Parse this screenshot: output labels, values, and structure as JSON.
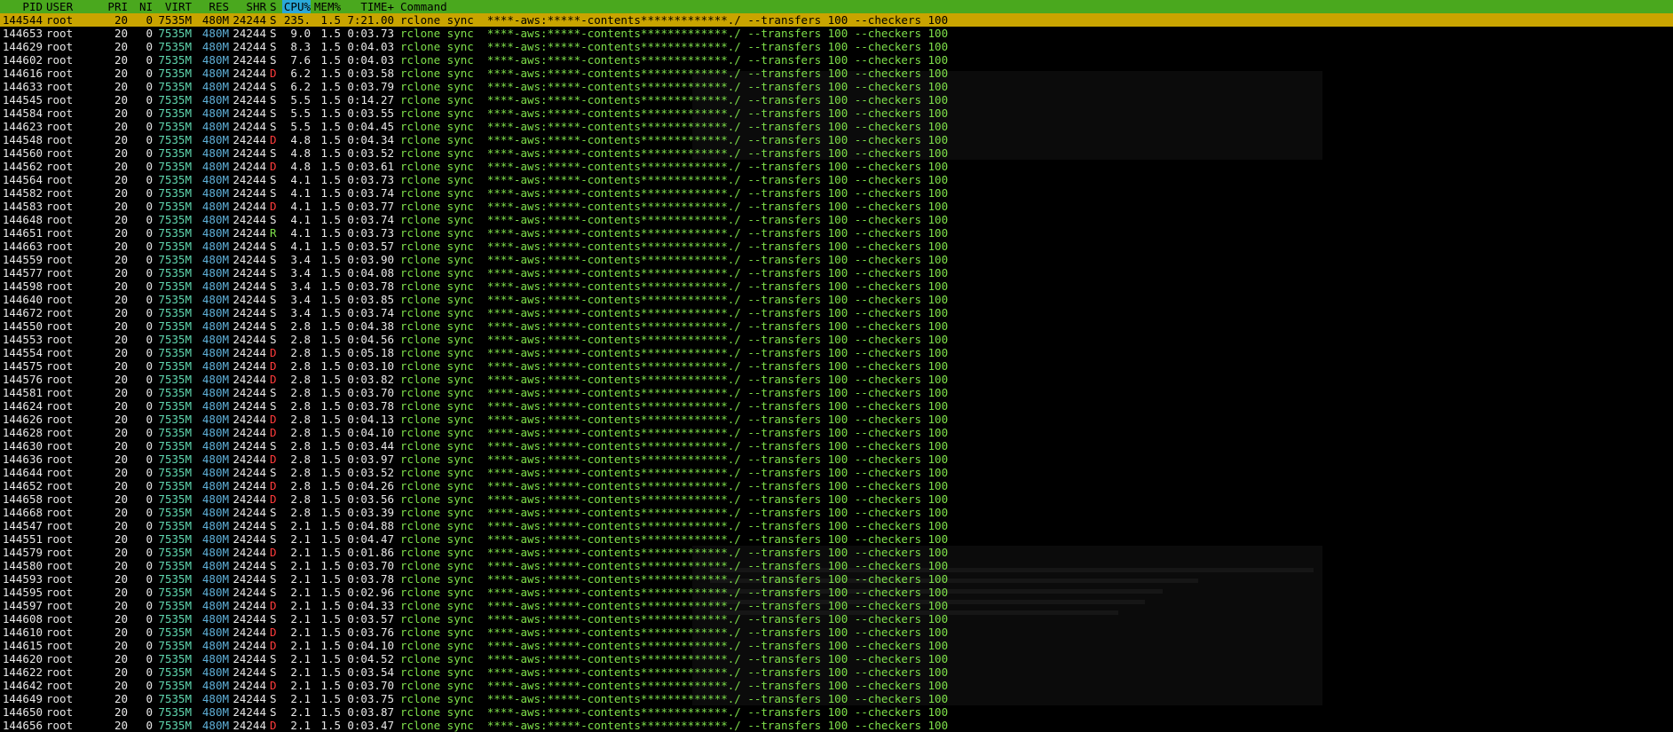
{
  "header": {
    "pid": "PID",
    "user": "USER",
    "pri": "PRI",
    "ni": "NI",
    "virt": "VIRT",
    "res": "RES",
    "shr": "SHR",
    "s": "S",
    "cpu": "CPU%",
    "mem": "MEM%",
    "time": "TIME+",
    "command": "Command"
  },
  "selected_index": 0,
  "command_text": "rclone sync  ****-aws:*****-contents*************./ --transfers 100 --checkers 100",
  "defaults": {
    "user": "root",
    "pri": "20",
    "ni": "0",
    "virt": "7535M",
    "res": "480M",
    "shr": "24244",
    "mem": "1.5"
  },
  "processes": [
    {
      "pid": "144544",
      "s": "S",
      "cpu": "235.",
      "time": "7:21.00"
    },
    {
      "pid": "144653",
      "s": "S",
      "cpu": "9.0",
      "time": "0:03.73"
    },
    {
      "pid": "144629",
      "s": "S",
      "cpu": "8.3",
      "time": "0:04.03"
    },
    {
      "pid": "144602",
      "s": "S",
      "cpu": "7.6",
      "time": "0:04.03"
    },
    {
      "pid": "144616",
      "s": "D",
      "cpu": "6.2",
      "time": "0:03.58"
    },
    {
      "pid": "144633",
      "s": "S",
      "cpu": "6.2",
      "time": "0:03.79"
    },
    {
      "pid": "144545",
      "s": "S",
      "cpu": "5.5",
      "time": "0:14.27"
    },
    {
      "pid": "144584",
      "s": "S",
      "cpu": "5.5",
      "time": "0:03.55"
    },
    {
      "pid": "144623",
      "s": "S",
      "cpu": "5.5",
      "time": "0:04.45"
    },
    {
      "pid": "144548",
      "s": "D",
      "cpu": "4.8",
      "time": "0:04.34"
    },
    {
      "pid": "144560",
      "s": "S",
      "cpu": "4.8",
      "time": "0:03.52"
    },
    {
      "pid": "144562",
      "s": "D",
      "cpu": "4.8",
      "time": "0:03.61"
    },
    {
      "pid": "144564",
      "s": "S",
      "cpu": "4.1",
      "time": "0:03.73"
    },
    {
      "pid": "144582",
      "s": "S",
      "cpu": "4.1",
      "time": "0:03.74"
    },
    {
      "pid": "144583",
      "s": "D",
      "cpu": "4.1",
      "time": "0:03.77"
    },
    {
      "pid": "144648",
      "s": "S",
      "cpu": "4.1",
      "time": "0:03.74"
    },
    {
      "pid": "144651",
      "s": "R",
      "cpu": "4.1",
      "time": "0:03.73"
    },
    {
      "pid": "144663",
      "s": "S",
      "cpu": "4.1",
      "time": "0:03.57"
    },
    {
      "pid": "144559",
      "s": "S",
      "cpu": "3.4",
      "time": "0:03.90"
    },
    {
      "pid": "144577",
      "s": "S",
      "cpu": "3.4",
      "time": "0:04.08"
    },
    {
      "pid": "144598",
      "s": "S",
      "cpu": "3.4",
      "time": "0:03.78"
    },
    {
      "pid": "144640",
      "s": "S",
      "cpu": "3.4",
      "time": "0:03.85"
    },
    {
      "pid": "144672",
      "s": "S",
      "cpu": "3.4",
      "time": "0:03.74"
    },
    {
      "pid": "144550",
      "s": "S",
      "cpu": "2.8",
      "time": "0:04.38"
    },
    {
      "pid": "144553",
      "s": "S",
      "cpu": "2.8",
      "time": "0:04.56"
    },
    {
      "pid": "144554",
      "s": "D",
      "cpu": "2.8",
      "time": "0:05.18"
    },
    {
      "pid": "144575",
      "s": "D",
      "cpu": "2.8",
      "time": "0:03.10"
    },
    {
      "pid": "144576",
      "s": "D",
      "cpu": "2.8",
      "time": "0:03.82"
    },
    {
      "pid": "144581",
      "s": "S",
      "cpu": "2.8",
      "time": "0:03.70"
    },
    {
      "pid": "144624",
      "s": "S",
      "cpu": "2.8",
      "time": "0:03.78"
    },
    {
      "pid": "144626",
      "s": "D",
      "cpu": "2.8",
      "time": "0:04.13"
    },
    {
      "pid": "144628",
      "s": "D",
      "cpu": "2.8",
      "time": "0:04.10"
    },
    {
      "pid": "144630",
      "s": "S",
      "cpu": "2.8",
      "time": "0:03.44"
    },
    {
      "pid": "144636",
      "s": "D",
      "cpu": "2.8",
      "time": "0:03.97"
    },
    {
      "pid": "144644",
      "s": "S",
      "cpu": "2.8",
      "time": "0:03.52"
    },
    {
      "pid": "144652",
      "s": "D",
      "cpu": "2.8",
      "time": "0:04.26"
    },
    {
      "pid": "144658",
      "s": "D",
      "cpu": "2.8",
      "time": "0:03.56"
    },
    {
      "pid": "144668",
      "s": "S",
      "cpu": "2.8",
      "time": "0:03.39"
    },
    {
      "pid": "144547",
      "s": "S",
      "cpu": "2.1",
      "time": "0:04.88"
    },
    {
      "pid": "144551",
      "s": "S",
      "cpu": "2.1",
      "time": "0:04.47"
    },
    {
      "pid": "144579",
      "s": "D",
      "cpu": "2.1",
      "time": "0:01.86"
    },
    {
      "pid": "144580",
      "s": "S",
      "cpu": "2.1",
      "time": "0:03.70"
    },
    {
      "pid": "144593",
      "s": "S",
      "cpu": "2.1",
      "time": "0:03.78"
    },
    {
      "pid": "144595",
      "s": "S",
      "cpu": "2.1",
      "time": "0:02.96"
    },
    {
      "pid": "144597",
      "s": "D",
      "cpu": "2.1",
      "time": "0:04.33"
    },
    {
      "pid": "144608",
      "s": "S",
      "cpu": "2.1",
      "time": "0:03.57"
    },
    {
      "pid": "144610",
      "s": "D",
      "cpu": "2.1",
      "time": "0:03.76"
    },
    {
      "pid": "144615",
      "s": "D",
      "cpu": "2.1",
      "time": "0:04.10"
    },
    {
      "pid": "144620",
      "s": "S",
      "cpu": "2.1",
      "time": "0:04.52"
    },
    {
      "pid": "144622",
      "s": "S",
      "cpu": "2.1",
      "time": "0:03.54"
    },
    {
      "pid": "144642",
      "s": "D",
      "cpu": "2.1",
      "time": "0:03.70"
    },
    {
      "pid": "144649",
      "s": "S",
      "cpu": "2.1",
      "time": "0:03.75"
    },
    {
      "pid": "144650",
      "s": "S",
      "cpu": "2.1",
      "time": "0:03.87"
    },
    {
      "pid": "144656",
      "s": "D",
      "cpu": "2.1",
      "time": "0:03.47"
    }
  ],
  "colors": {
    "header_bg": "#4aa81e",
    "sort_column_bg": "#2aa8d8",
    "selected_row_bg": "#c9a400",
    "command_fg": "#7ee04a",
    "virt_fg": "#5fd7af",
    "res_fg": "#5fb0d8",
    "state_d_fg": "#ff3b3b"
  }
}
